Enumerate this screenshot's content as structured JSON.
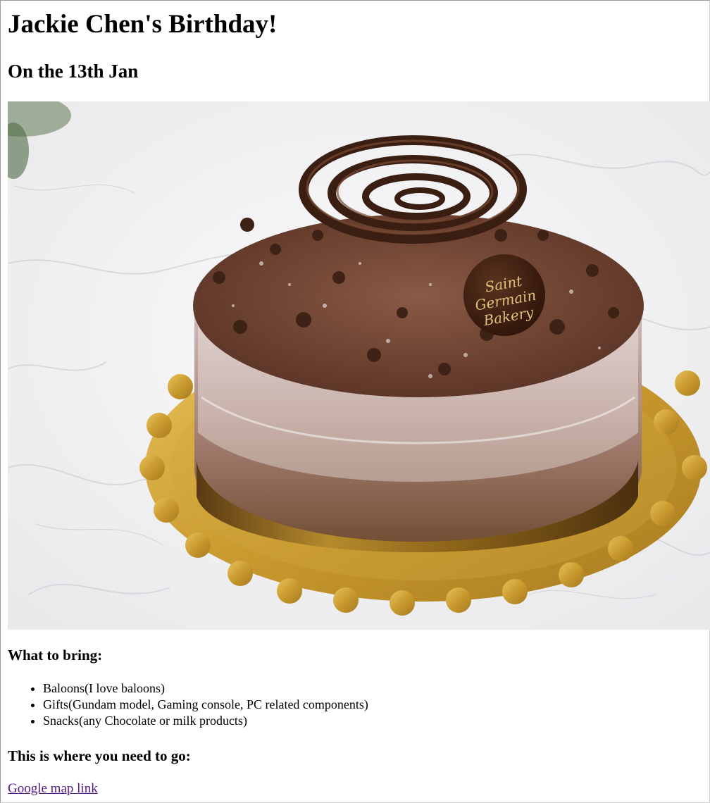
{
  "page": {
    "title": "Jackie Chen's Birthday!",
    "subtitle": "On the 13th Jan"
  },
  "image": {
    "icon": "cake-photo",
    "plaque_line1": "Saint",
    "plaque_line2": "Germain",
    "plaque_line3": "Bakery"
  },
  "bring": {
    "heading": "What to bring:",
    "items": [
      "Baloons(I love baloons)",
      "Gifts(Gundam model, Gaming console, PC related components)",
      "Snacks(any Chocolate or milk products)"
    ]
  },
  "location": {
    "heading": "This is where you need to go:",
    "link_text": "Google map link"
  },
  "colors": {
    "link_visited": "#551a8b",
    "text": "#000000",
    "background": "#ffffff"
  }
}
